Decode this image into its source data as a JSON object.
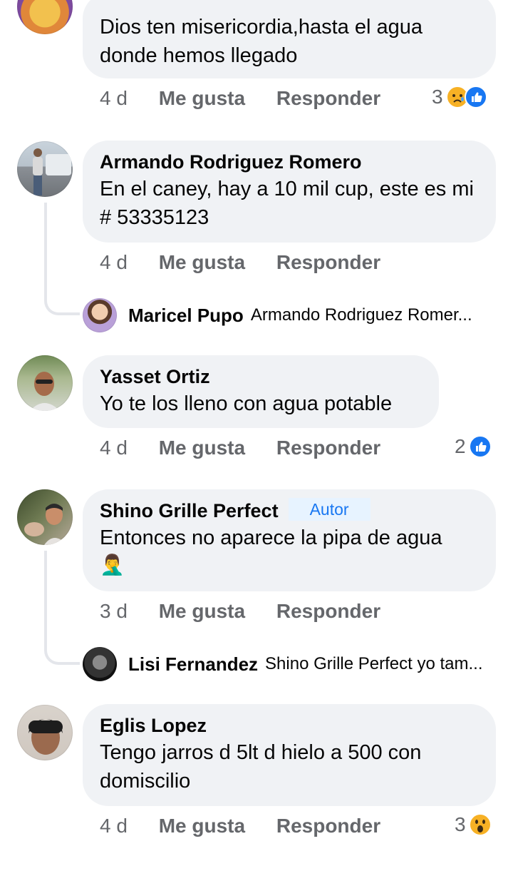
{
  "comments": [
    {
      "id": "c0",
      "text": "Dios ten misericordia,hasta el agua donde hemos llegado",
      "time": "4 d",
      "like_label": "Me gusta",
      "reply_label": "Responder",
      "reaction_count": "3",
      "reactions": [
        "sad-icon",
        "like-icon"
      ]
    },
    {
      "id": "c1",
      "author": "Armando Rodriguez Romero",
      "text": "En el caney, hay a 10 mil cup, este es mi # 53335123",
      "time": "4 d",
      "like_label": "Me gusta",
      "reply_label": "Responder",
      "reply_preview": {
        "author": "Maricel Pupo",
        "text": "Armando Rodriguez Romer..."
      }
    },
    {
      "id": "c2",
      "author": "Yasset Ortiz",
      "text": "Yo te los lleno con agua potable",
      "time": "4 d",
      "like_label": "Me gusta",
      "reply_label": "Responder",
      "reaction_count": "2",
      "reactions": [
        "like-icon"
      ]
    },
    {
      "id": "c3",
      "author": "Shino Grille Perfect",
      "badge": "Autor",
      "text": "Entonces no aparece la pipa de agua",
      "emoji": "🤦‍♂️",
      "time": "3 d",
      "like_label": "Me gusta",
      "reply_label": "Responder",
      "reply_preview": {
        "author": "Lisi Fernandez",
        "text": "Shino Grille Perfect yo tam..."
      }
    },
    {
      "id": "c4",
      "author": "Eglis Lopez",
      "text": "Tengo jarros d 5lt d hielo a 500 con domiscilio",
      "time": "4 d",
      "like_label": "Me gusta",
      "reply_label": "Responder",
      "reaction_count": "3",
      "reactions": [
        "wow-icon"
      ]
    }
  ],
  "colors": {
    "bubble": "#f0f2f5",
    "meta_text": "#65676b",
    "like_blue": "#1877f2",
    "thread_line": "#e4e6eb",
    "author_badge_bg": "#e7f3ff"
  }
}
